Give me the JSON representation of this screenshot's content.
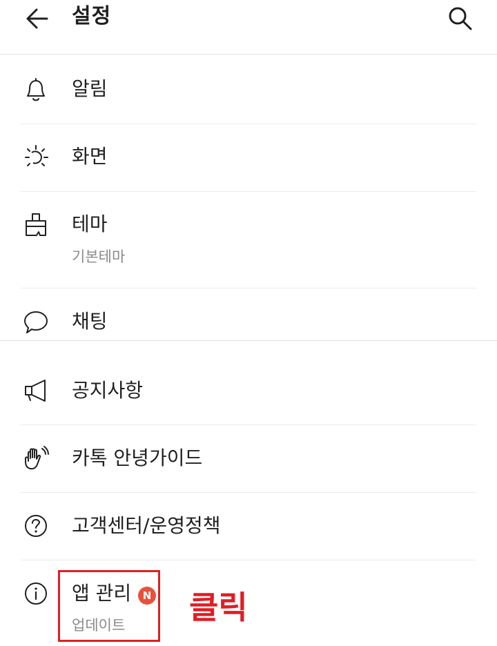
{
  "header": {
    "title": "설정",
    "back_icon": "arrow-left-icon",
    "search_icon": "search-icon"
  },
  "settings": {
    "items": [
      {
        "icon": "bell-icon",
        "label": "알림"
      },
      {
        "icon": "brightness-icon",
        "label": "화면"
      },
      {
        "icon": "brush-icon",
        "label": "테마",
        "sub": "기본테마"
      },
      {
        "icon": "chat-bubble-icon",
        "label": "채팅"
      }
    ]
  },
  "info": {
    "items": [
      {
        "icon": "megaphone-icon",
        "label": "공지사항"
      },
      {
        "icon": "hand-wave-icon",
        "label": "카톡 안녕가이드"
      },
      {
        "icon": "question-circle-icon",
        "label": "고객센터/운영정책"
      },
      {
        "icon": "info-circle-icon",
        "label": "앱 관리",
        "sub": "업데이트",
        "badge": "N"
      }
    ]
  },
  "annotation": {
    "text": "클릭",
    "color": "#e01e23"
  },
  "colors": {
    "badge": "#e8513a",
    "divider": "#ececec"
  }
}
